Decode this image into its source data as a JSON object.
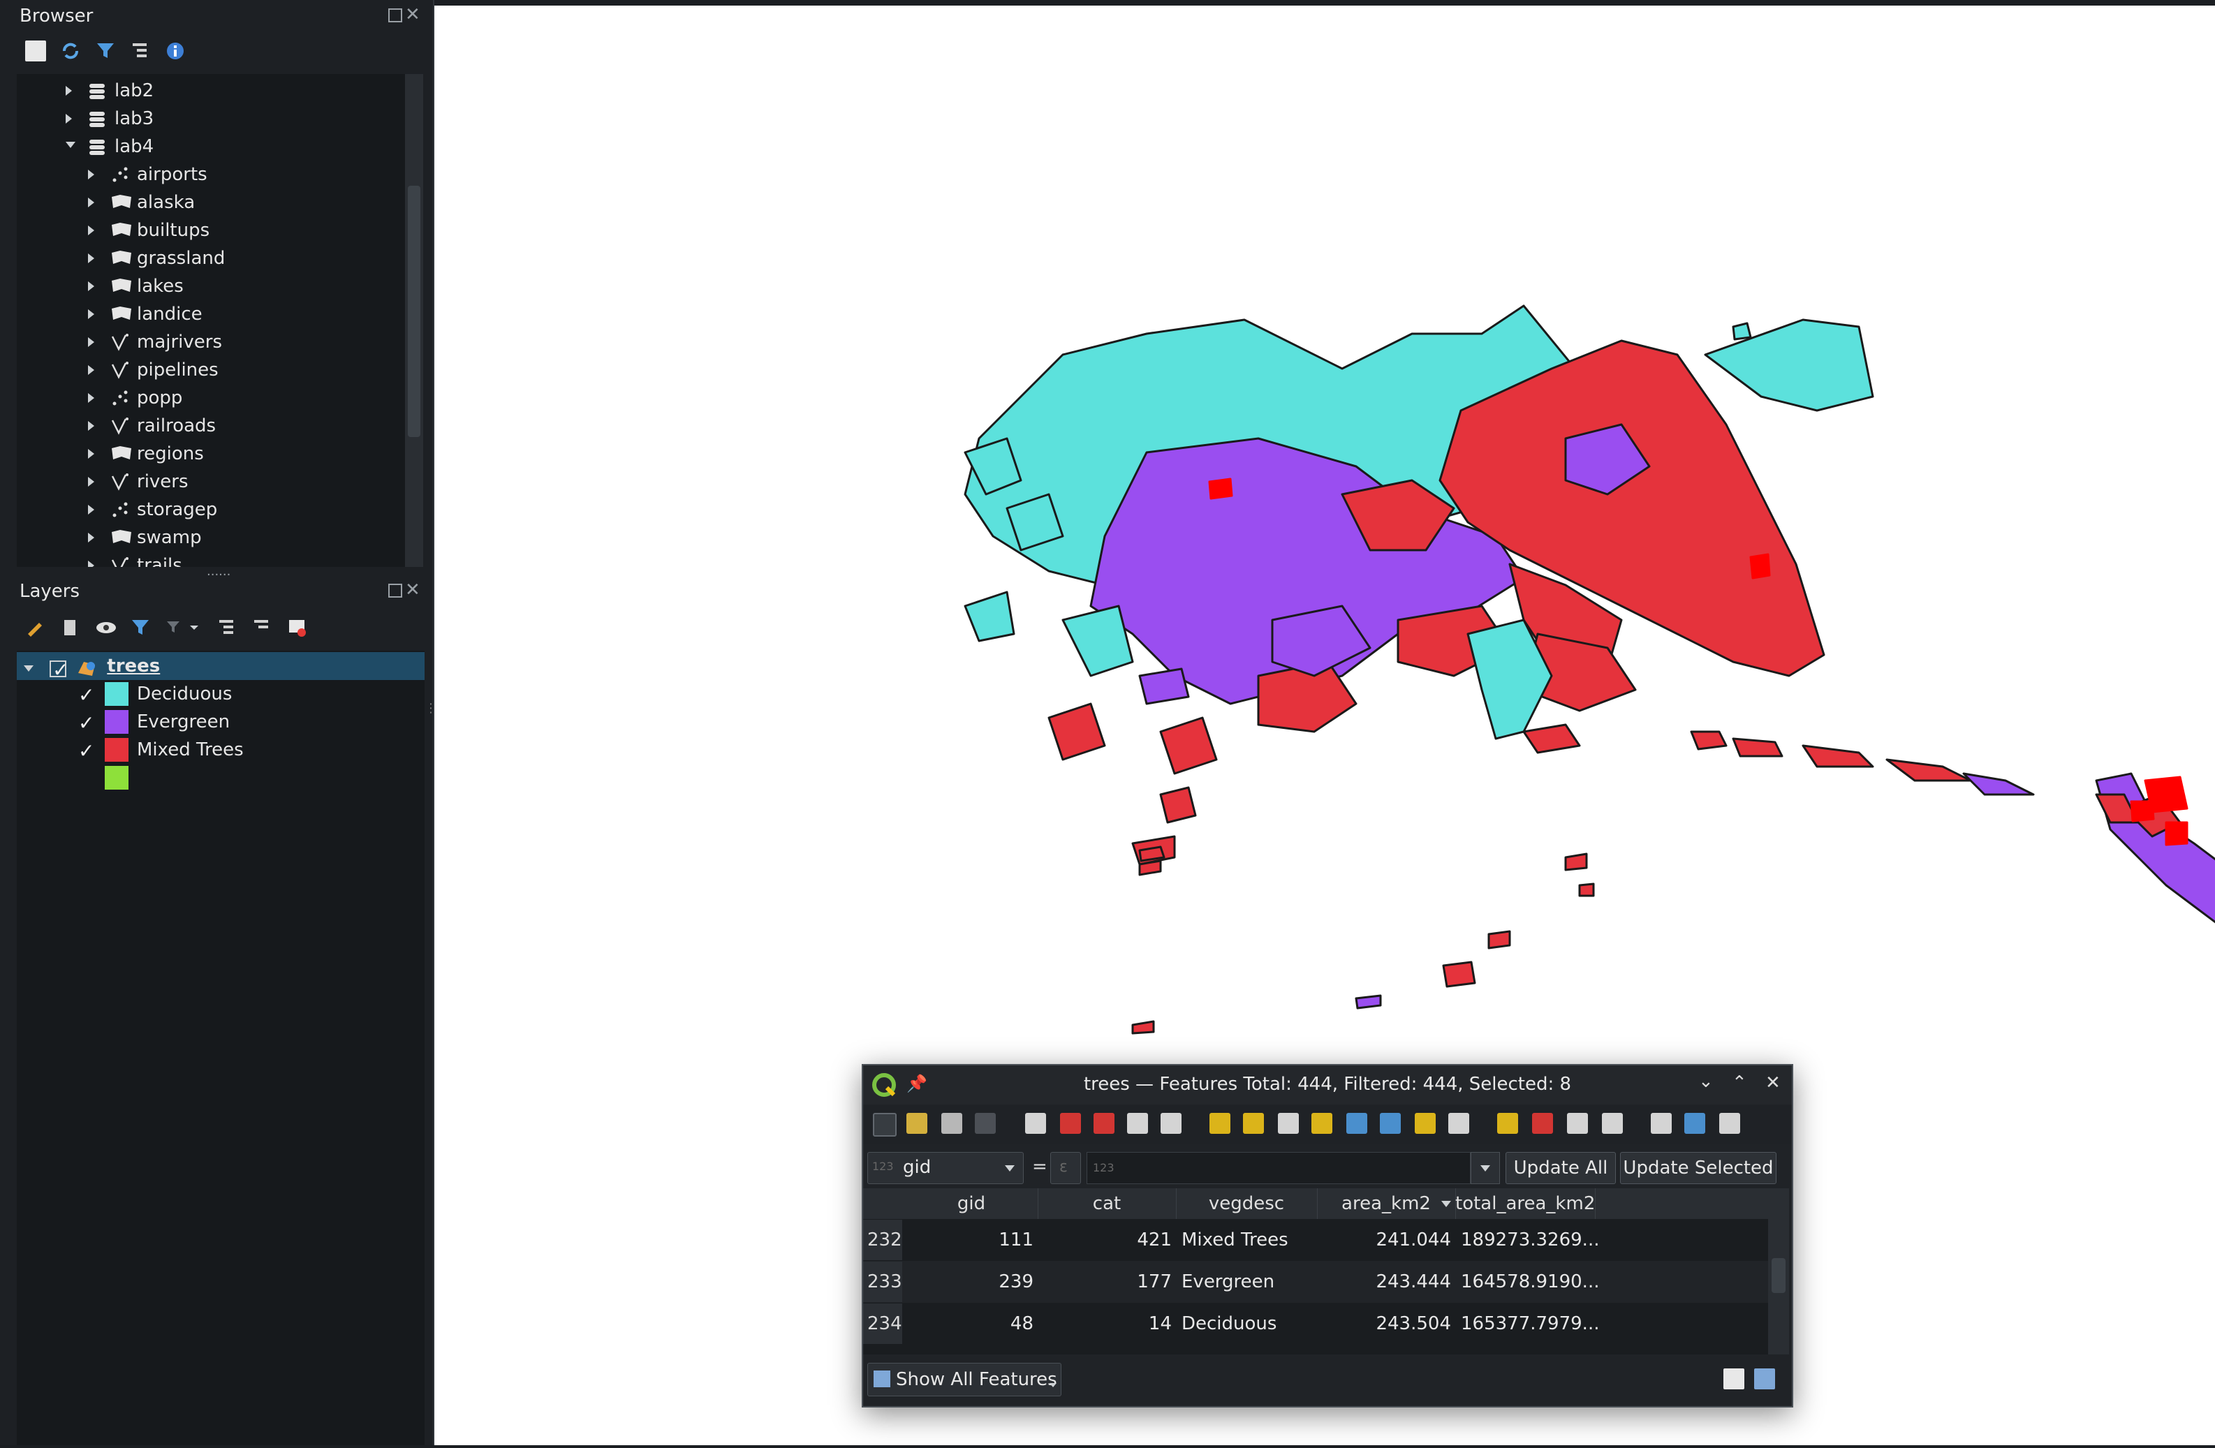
{
  "browser": {
    "title": "Browser",
    "items": [
      {
        "label": "lab2",
        "type": "db",
        "level": 0,
        "expanded": false
      },
      {
        "label": "lab3",
        "type": "db",
        "level": 0,
        "expanded": false
      },
      {
        "label": "lab4",
        "type": "db",
        "level": 0,
        "expanded": true
      },
      {
        "label": "airports",
        "type": "point",
        "level": 1
      },
      {
        "label": "alaska",
        "type": "polygon",
        "level": 1
      },
      {
        "label": "builtups",
        "type": "polygon",
        "level": 1
      },
      {
        "label": "grassland",
        "type": "polygon",
        "level": 1
      },
      {
        "label": "lakes",
        "type": "polygon",
        "level": 1
      },
      {
        "label": "landice",
        "type": "polygon",
        "level": 1
      },
      {
        "label": "majrivers",
        "type": "line",
        "level": 1
      },
      {
        "label": "pipelines",
        "type": "line",
        "level": 1
      },
      {
        "label": "popp",
        "type": "point",
        "level": 1
      },
      {
        "label": "railroads",
        "type": "line",
        "level": 1
      },
      {
        "label": "regions",
        "type": "polygon",
        "level": 1
      },
      {
        "label": "rivers",
        "type": "line",
        "level": 1
      },
      {
        "label": "storagep",
        "type": "point",
        "level": 1
      },
      {
        "label": "swamp",
        "type": "polygon",
        "level": 1
      },
      {
        "label": "trails",
        "type": "line",
        "level": 1
      }
    ]
  },
  "layers": {
    "title": "Layers",
    "layer_name": "trees",
    "legend": [
      {
        "label": "Deciduous",
        "color": "#5ce1dc",
        "checked": true
      },
      {
        "label": "Evergreen",
        "color": "#9a4ef0",
        "checked": true
      },
      {
        "label": "Mixed Trees",
        "color": "#e5333c",
        "checked": true
      },
      {
        "label": "",
        "color": "#8ee03a",
        "checked": false
      }
    ]
  },
  "map": {
    "colors": {
      "deciduous": "#5ce1dc",
      "evergreen": "#9a4ef0",
      "mixed": "#e5333c",
      "selected": "#ff0000",
      "outline": "#1a1a1a"
    }
  },
  "attr_table": {
    "title": "trees — Features Total: 444, Filtered: 444, Selected: 8",
    "field_select": "gid",
    "field_prefix": "123",
    "equals": "=",
    "expr_placeholder": "123",
    "update_all": "Update All",
    "update_selected": "Update Selected",
    "columns": [
      "gid",
      "cat",
      "vegdesc",
      "area_km2",
      "total_area_km2"
    ],
    "rows": [
      {
        "num": "232",
        "gid": "111",
        "cat": "421",
        "vegdesc": "Mixed Trees",
        "area": "241.044",
        "total": "189273.3269..."
      },
      {
        "num": "233",
        "gid": "239",
        "cat": "177",
        "vegdesc": "Evergreen",
        "area": "243.444",
        "total": "164578.9190..."
      },
      {
        "num": "234",
        "gid": "48",
        "cat": "14",
        "vegdesc": "Deciduous",
        "area": "243.504",
        "total": "165377.7979..."
      }
    ],
    "show_all": "Show All Features"
  }
}
